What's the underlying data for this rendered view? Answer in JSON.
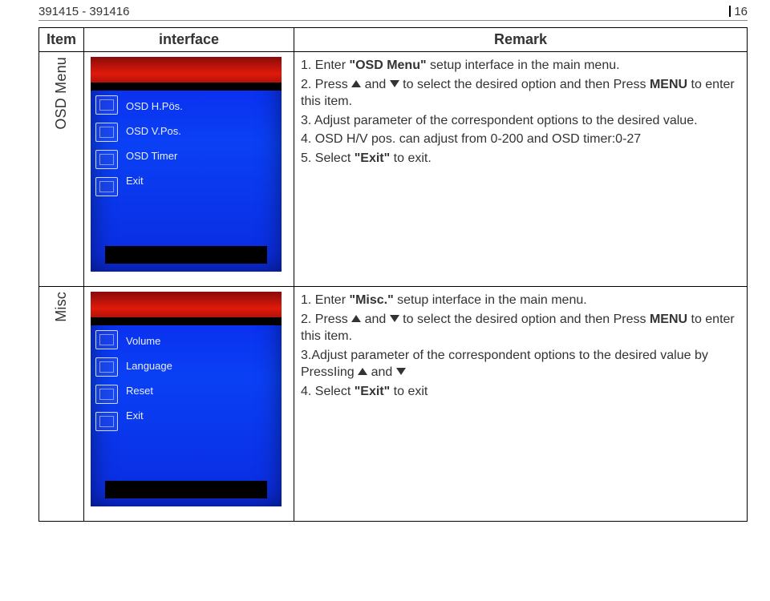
{
  "header": {
    "doc_range": "391415 - 391416",
    "page_number": "16"
  },
  "table": {
    "columns": {
      "item": "Item",
      "interface": "interface",
      "remark": "Remark"
    },
    "rows": [
      {
        "item_label": "OSD Menu",
        "osd_items": [
          "OSD H.Pös.",
          "OSD V.Pos.",
          "OSD Timer",
          "Exit"
        ],
        "remark_lines": {
          "l1a": "1. Enter ",
          "l1b": "\"OSD Menu\"",
          "l1c": " setup interface in the main menu.",
          "l2a": "2. Press ",
          "l2b": " and ",
          "l2c": " to select the desired option and then Press ",
          "l2d": "MENU",
          "l2e": " to enter this item.",
          "l3": "3. Adjust parameter of the correspondent options to the desired value.",
          "l4": "4. OSD H/V pos. can adjust from 0-200 and OSD timer:0-27",
          "l5a": "5. Select ",
          "l5b": "\"Exit\"",
          "l5c": " to exit."
        }
      },
      {
        "item_label": "Misc",
        "osd_items": [
          "Volume",
          "Language",
          "Reset",
          "Exit"
        ],
        "remark_lines": {
          "l1a": "1. Enter ",
          "l1b": "\"Misc.\"",
          "l1c": " setup interface in the main menu.",
          "l2a": "2. Press ",
          "l2b": " and ",
          "l2c": " to select  the desired option and then Press ",
          "l2d": "MENU",
          "l2e": " to enter this item.",
          "l3a": "3.Adjust parameter of the correspondent options to the desired value by PressIing ",
          "l3b": " and ",
          "l4a": "4. Select ",
          "l4b": "\"Exit\"",
          "l4c": " to exit"
        }
      }
    ]
  }
}
